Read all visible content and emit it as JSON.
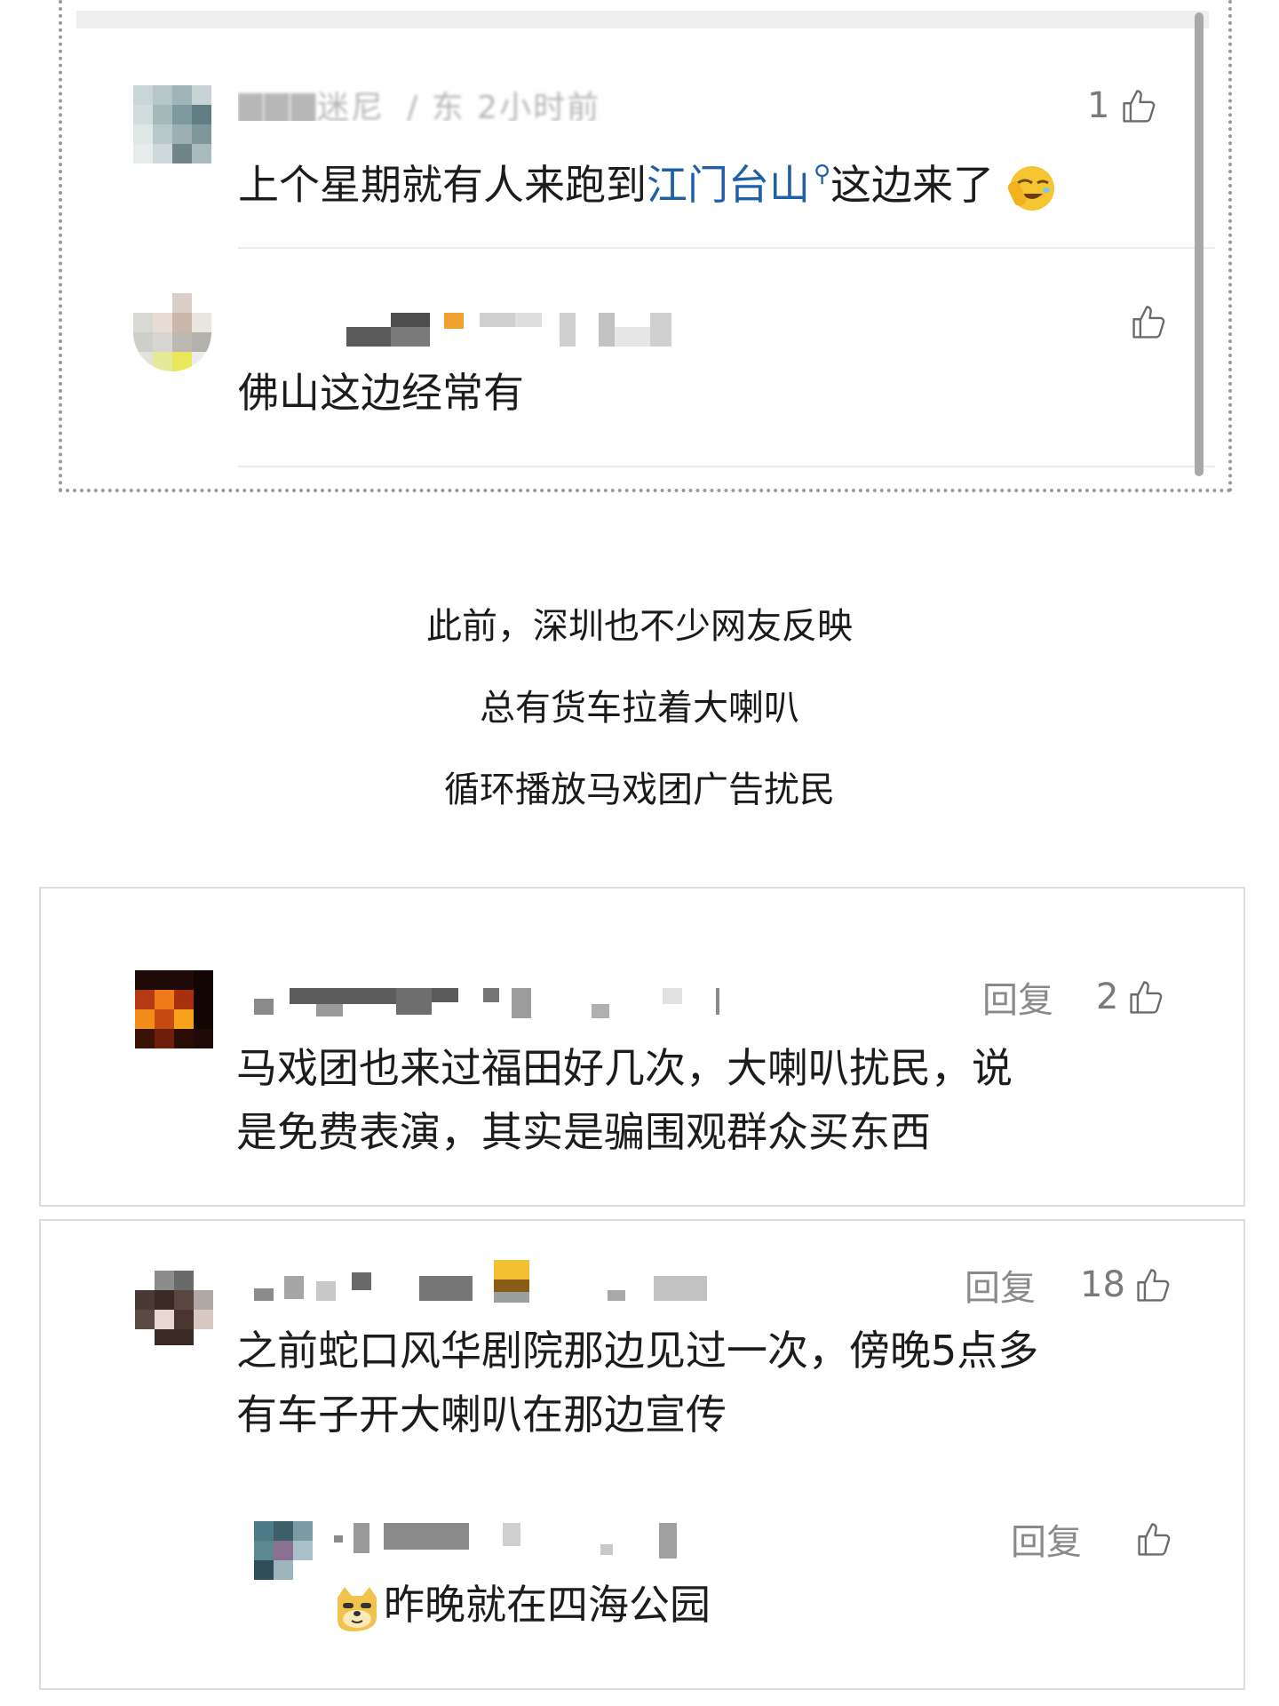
{
  "thread_top": {
    "comment_1": {
      "username_blurred": "▇▇▇迷尼",
      "meta_blurred": "/ 东 2小时前",
      "text_before_link": "上个星期就有人来跑到",
      "link_text": "江门台山",
      "text_after_link": "这边来了",
      "emoji": "facepalm-laugh-emoji",
      "like_count": "1"
    },
    "comment_2": {
      "text": "佛山这边经常有",
      "like_count": ""
    }
  },
  "article": {
    "lines": [
      "此前，深圳也不少网友反映",
      "总有货车拉着大喇叭",
      "循环播放马戏团广告扰民"
    ]
  },
  "comment_card_1": {
    "reply_label": "回复",
    "like_count": "2",
    "line_1": "马戏团也来过福田好几次，大喇叭扰民，说",
    "line_2": "是免费表演，其实是骗围观群众买东西"
  },
  "comment_card_2": {
    "reply_label": "回复",
    "like_count": "18",
    "line_1": "之前蛇口风华剧院那边见过一次，傍晚5点多",
    "line_2": "有车子开大喇叭在那边宣传",
    "reply": {
      "reply_label": "回复",
      "emoji": "doge-emoji",
      "text": "昨晚就在四海公园"
    }
  },
  "colors": {
    "link": "#1f5fa8",
    "text": "#1c1c1c",
    "muted": "#8a8a8a"
  }
}
